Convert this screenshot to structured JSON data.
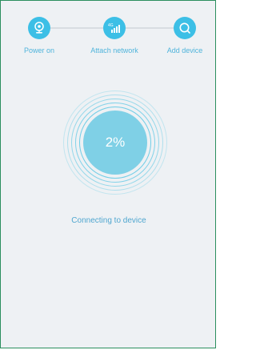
{
  "steps": [
    {
      "label": "Power on",
      "icon": "camera-icon"
    },
    {
      "label": "Attach network",
      "icon": "signal-4g-icon",
      "badge": "4G"
    },
    {
      "label": "Add device",
      "icon": "search-icon"
    }
  ],
  "progress": {
    "percent_text": "2%",
    "value": 0.02
  },
  "status": {
    "text": "Connecting to device"
  },
  "colors": {
    "accent": "#3cbfe6",
    "progress_fill": "#7fd0e6",
    "label": "#4fb4db",
    "background": "#eef1f4"
  }
}
